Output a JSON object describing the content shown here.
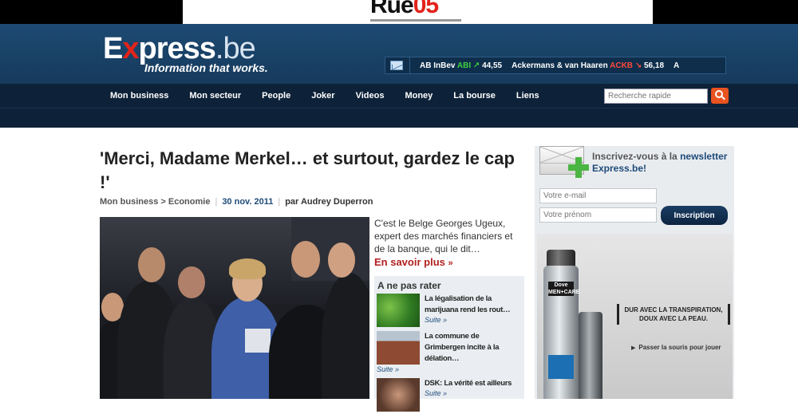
{
  "top_ad": {
    "text_black": "Rue",
    "text_red": "05"
  },
  "logo": {
    "text_e": "E",
    "text_x": "x",
    "text_press": "press",
    "text_dot_be": ".be",
    "tagline": "Information that works."
  },
  "ticker": [
    {
      "name": "AB InBev",
      "code": "ABI",
      "trend": "up",
      "value": "44,55"
    },
    {
      "name": "Ackermans & van Haaren",
      "code": "ACKB",
      "trend": "down",
      "value": "56,18"
    },
    {
      "name": "A",
      "code": "",
      "trend": "",
      "value": ""
    }
  ],
  "nav": {
    "items": [
      "Mon business",
      "Mon secteur",
      "People",
      "Joker",
      "Videos",
      "Money",
      "La bourse",
      "Liens"
    ],
    "search_placeholder": "Recherche rapide"
  },
  "article": {
    "title": "'Merci, Madame Merkel… et surtout, gardez le cap !'",
    "breadcrumb": "Mon business > Economie",
    "date": "30 nov. 2011",
    "author": "par Audrey Duperron",
    "lead": "C'est le Belge Georges Ugeux, expert des marchés financiers et de la banque, qui le dit…",
    "more_label": "En savoir plus",
    "more_arrow": "»"
  },
  "dont_miss": {
    "title": "A ne pas rater",
    "items": [
      {
        "text": "La légalisation de la marijuana rend les rout…",
        "suite": "Suite »"
      },
      {
        "text": "La commune de Grimbergen incite à la délation…",
        "suite": "Suite »"
      },
      {
        "text": "DSK: La vérité est ailleurs",
        "suite": "Suite »"
      }
    ]
  },
  "newsletter": {
    "text_prefix": "Inscrivez-vous à la ",
    "text_link": "newsletter Express.be",
    "text_suffix": "!",
    "email_placeholder": "Votre e-mail",
    "firstname_placeholder": "Votre prénom",
    "button_label": "Inscription"
  },
  "side_ad": {
    "brand": "Dove MEN+CARE",
    "headline": "DUR AVEC LA TRANSPIRATION, DOUX AVEC LA PEAU.",
    "cta": "Passer la souris pour jouer"
  },
  "colors": {
    "accent_red": "#b21f1f",
    "header_blue": "#1d4a73",
    "nav_dark": "#0d2238",
    "search_orange": "#e8531f",
    "green": "#4bb543"
  }
}
